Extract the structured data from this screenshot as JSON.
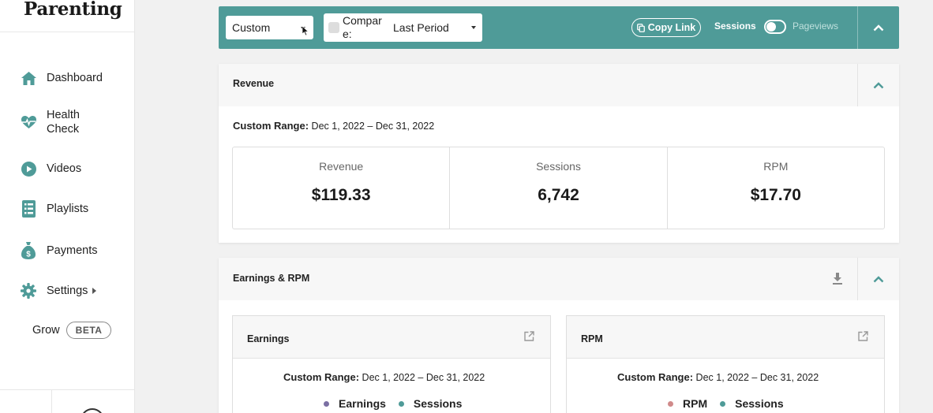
{
  "brand": "Parenting",
  "sidebar": {
    "items": [
      {
        "label": "Dashboard",
        "icon": "home-icon"
      },
      {
        "label": "Health\nCheck",
        "icon": "heartbeat-icon"
      },
      {
        "label": "Videos",
        "icon": "play-circle-icon"
      },
      {
        "label": "Playlists",
        "icon": "list-icon"
      },
      {
        "label": "Payments",
        "icon": "money-bag-icon"
      },
      {
        "label": "Settings",
        "icon": "gear-icon"
      }
    ],
    "grow_label": "Grow",
    "beta_badge": "BETA"
  },
  "filters": {
    "range_select": "Custom",
    "compare_label": "Compare:",
    "compare_value": "Last Period",
    "copy_link": "Copy Link",
    "toggle_on_label": "Sessions",
    "toggle_off_label": "Pageviews"
  },
  "revenue_card": {
    "title": "Revenue",
    "range_label": "Custom Range:",
    "range_value": "Dec 1, 2022 – Dec 31, 2022",
    "metrics": [
      {
        "label": "Revenue",
        "value": "$119.33"
      },
      {
        "label": "Sessions",
        "value": "6,742"
      },
      {
        "label": "RPM",
        "value": "$17.70"
      }
    ]
  },
  "earnings_card": {
    "title": "Earnings & RPM",
    "earnings": {
      "title": "Earnings",
      "range_label": "Custom Range:",
      "range_value": "Dec 1, 2022 – Dec 31, 2022",
      "legend": [
        "Earnings",
        "Sessions"
      ]
    },
    "rpm": {
      "title": "RPM",
      "range_label": "Custom Range:",
      "range_value": "Dec 1, 2022 – Dec 31, 2022",
      "legend": [
        "RPM",
        "Sessions"
      ]
    }
  },
  "colors": {
    "accent": "#4f9b98",
    "earnings_dot": "#7b6fa3",
    "sessions_dot": "#4f9b98",
    "rpm_dot": "#d08a8a"
  }
}
